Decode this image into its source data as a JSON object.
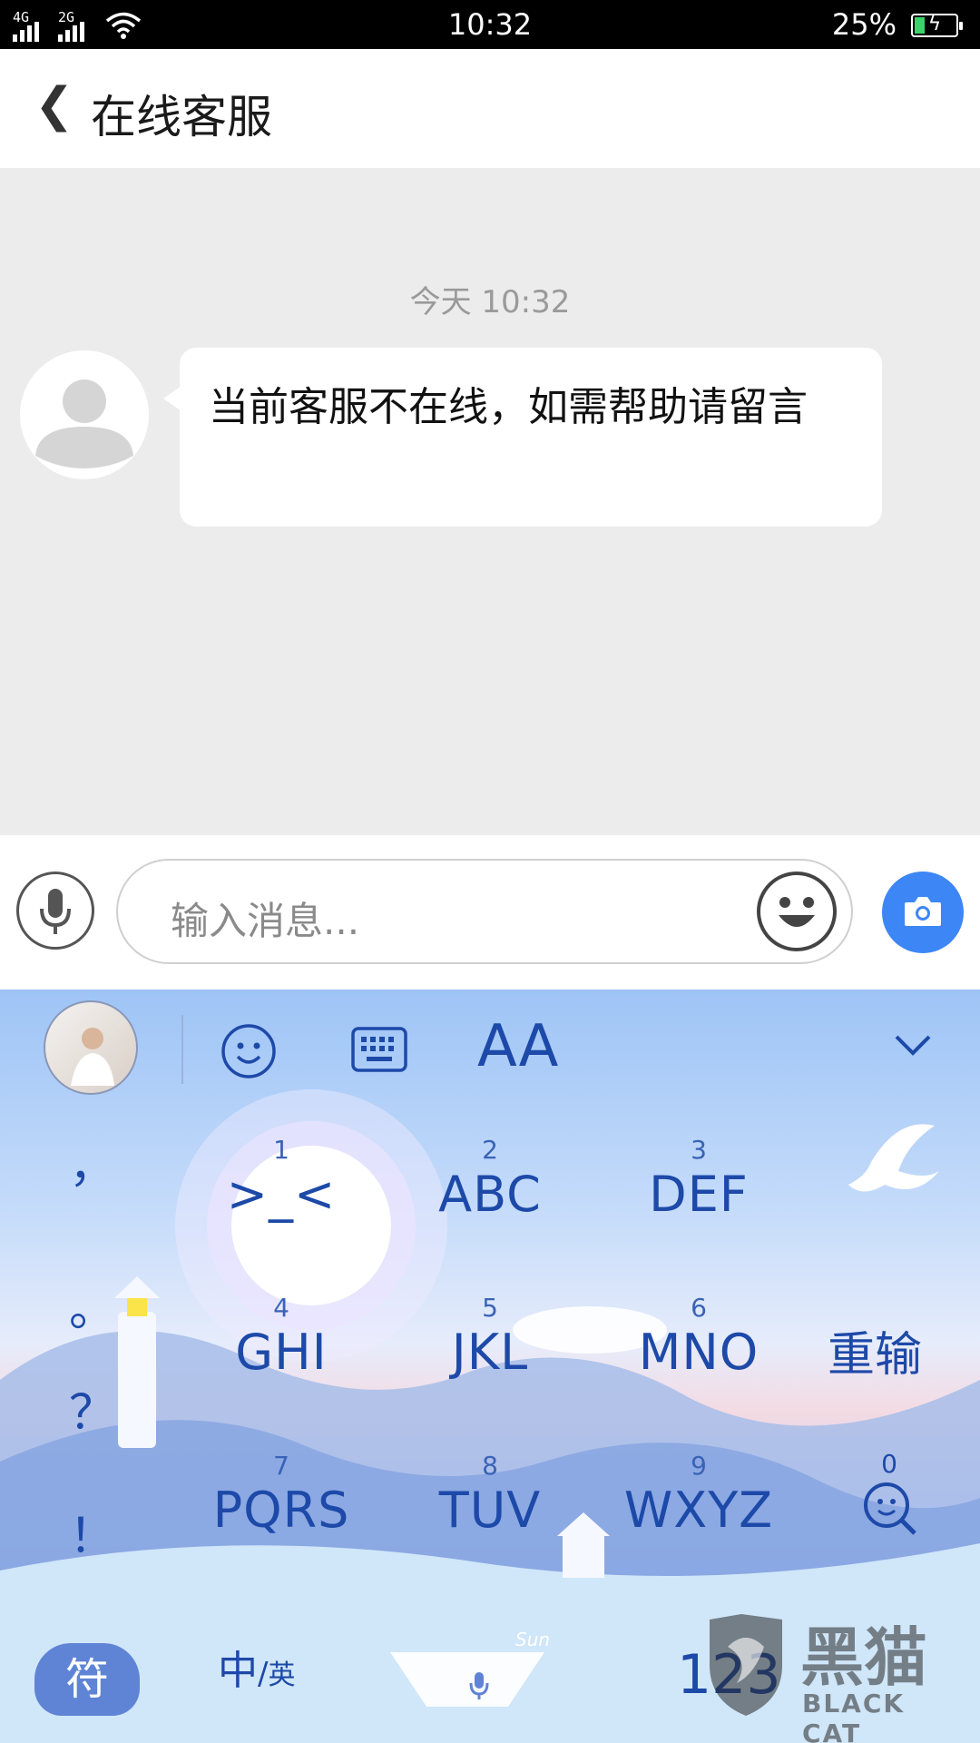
{
  "status_bar": {
    "network_1": "4G",
    "network_2": "2G",
    "time": "10:32",
    "battery": "25%",
    "battery_level": 0.25
  },
  "header": {
    "back_label": "❮",
    "title": "在线客服"
  },
  "chat": {
    "timestamp": "今天 10:32",
    "messages": [
      {
        "sender": "agent",
        "text": "当前客服不在线，如需帮助请留言"
      }
    ]
  },
  "input_bar": {
    "placeholder": "输入消息..."
  },
  "keyboard": {
    "toolbar_font_label": "AA",
    "keys": [
      {
        "num": "1",
        "label": ">_<"
      },
      {
        "num": "2",
        "label": "ABC"
      },
      {
        "num": "3",
        "label": "DEF"
      },
      {
        "num": "4",
        "label": "GHI"
      },
      {
        "num": "5",
        "label": "JKL"
      },
      {
        "num": "6",
        "label": "MNO"
      },
      {
        "num": "7",
        "label": "PQRS"
      },
      {
        "num": "8",
        "label": "TUV"
      },
      {
        "num": "9",
        "label": "WXYZ"
      }
    ],
    "punctuation": [
      "，",
      "。",
      "？",
      "！"
    ],
    "reenter": "重输",
    "zero": "0",
    "symbols": "符",
    "lang_zh": "中",
    "lang_en": "英",
    "space_label": "Sun",
    "numbers": "123"
  },
  "watermark": {
    "zh": "黑猫",
    "en": "BLACK CAT"
  },
  "colors": {
    "accent": "#3d86f5",
    "keyboard_text": "#1d49a8"
  }
}
